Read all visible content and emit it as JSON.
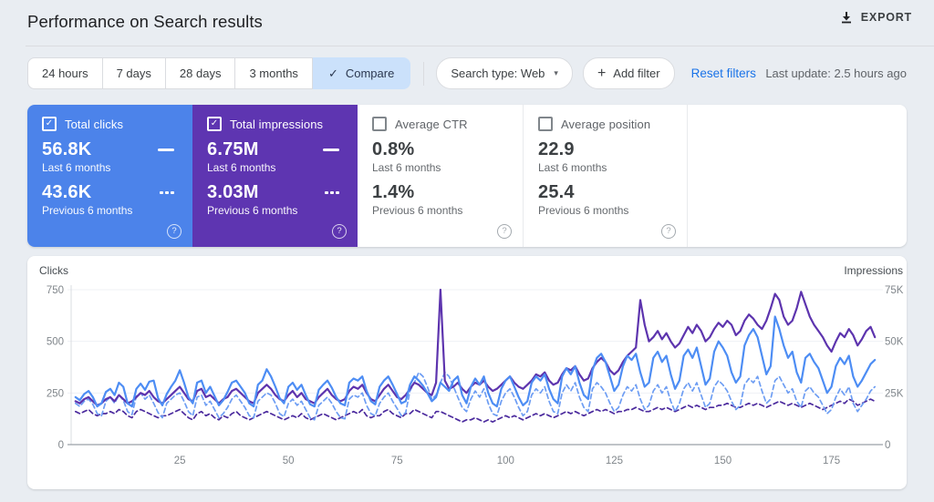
{
  "header": {
    "title": "Performance on Search results",
    "export_label": "EXPORT"
  },
  "glyphs": {
    "check": "✓",
    "plus": "+",
    "caret": "▾",
    "question": "?"
  },
  "filters": {
    "date_chips": [
      {
        "label": "24 hours",
        "selected": false
      },
      {
        "label": "7 days",
        "selected": false
      },
      {
        "label": "28 days",
        "selected": false
      },
      {
        "label": "3 months",
        "selected": false
      },
      {
        "label": "Compare",
        "selected": true
      }
    ],
    "search_type_label": "Search type: Web",
    "add_filter_label": "Add filter",
    "reset_filters_label": "Reset filters",
    "last_update": "Last update: 2.5 hours ago"
  },
  "metric_cards": [
    {
      "label": "Total clicks",
      "checked": true,
      "color": "#4c83ea",
      "value_current": "56.8K",
      "caption_current": "Last 6 months",
      "value_previous": "43.6K",
      "caption_previous": "Previous 6 months"
    },
    {
      "label": "Total impressions",
      "checked": true,
      "color": "#5e35b1",
      "value_current": "6.75M",
      "caption_current": "Last 6 months",
      "value_previous": "3.03M",
      "caption_previous": "Previous 6 months"
    },
    {
      "label": "Average CTR",
      "checked": false,
      "color": "#ffffff",
      "value_current": "0.8%",
      "caption_current": "Last 6 months",
      "value_previous": "1.4%",
      "caption_previous": "Previous 6 months"
    },
    {
      "label": "Average position",
      "checked": false,
      "color": "#ffffff",
      "value_current": "22.9",
      "caption_current": "Last 6 months",
      "value_previous": "25.4",
      "caption_previous": "Previous 6 months"
    }
  ],
  "chart_data": {
    "type": "line",
    "title": "Performance on Search results — clicks and impressions, last 6 months vs previous 6 months (daily)",
    "legend": "none",
    "grid": true,
    "axes": {
      "left": {
        "label": "Clicks",
        "ticks": [
          "0",
          "250",
          "500",
          "750"
        ],
        "tick_values": [
          0,
          250,
          500,
          750
        ],
        "range": [
          0,
          750
        ]
      },
      "right": {
        "label": "Impressions",
        "ticks": [
          "0",
          "25K",
          "50K",
          "75K"
        ],
        "tick_values": [
          0,
          25,
          50,
          75
        ],
        "range_thousands": [
          0,
          75
        ]
      },
      "x": {
        "ticks": [
          25,
          50,
          75,
          100,
          125,
          150,
          175
        ],
        "range": [
          0,
          186
        ],
        "unit": "day index"
      }
    },
    "series": [
      {
        "name": "Clicks — Last 6 months",
        "axis": "left",
        "style": "solid",
        "color": "#4d8df4",
        "unit": "clicks",
        "values": [
          230,
          215,
          245,
          260,
          230,
          185,
          200,
          255,
          270,
          240,
          300,
          280,
          200,
          185,
          270,
          295,
          265,
          305,
          310,
          225,
          190,
          245,
          280,
          310,
          360,
          300,
          230,
          200,
          300,
          310,
          250,
          280,
          235,
          190,
          215,
          255,
          300,
          310,
          280,
          250,
          200,
          185,
          290,
          310,
          365,
          330,
          280,
          225,
          200,
          280,
          300,
          265,
          290,
          240,
          195,
          185,
          265,
          290,
          310,
          275,
          230,
          200,
          190,
          300,
          320,
          310,
          330,
          260,
          210,
          195,
          280,
          310,
          330,
          290,
          245,
          200,
          210,
          290,
          330,
          310,
          285,
          250,
          210,
          230,
          300,
          280,
          260,
          310,
          330,
          240,
          200,
          280,
          320,
          290,
          330,
          250,
          200,
          185,
          270,
          310,
          330,
          280,
          230,
          190,
          210,
          300,
          330,
          310,
          340,
          270,
          220,
          200,
          330,
          370,
          340,
          380,
          300,
          240,
          220,
          360,
          420,
          440,
          400,
          330,
          260,
          290,
          380,
          430,
          410,
          440,
          350,
          280,
          300,
          420,
          450,
          400,
          430,
          340,
          270,
          310,
          430,
          460,
          420,
          470,
          380,
          290,
          320,
          450,
          500,
          470,
          430,
          350,
          300,
          330,
          480,
          530,
          560,
          520,
          430,
          340,
          380,
          620,
          560,
          480,
          420,
          450,
          350,
          300,
          420,
          440,
          400,
          370,
          310,
          250,
          280,
          380,
          420,
          390,
          430,
          330,
          280,
          310,
          350,
          390,
          410
        ]
      },
      {
        "name": "Clicks — Previous 6 months",
        "axis": "left",
        "style": "dashed",
        "color": "#6d9df3",
        "unit": "clicks",
        "values": [
          200,
          185,
          210,
          220,
          195,
          150,
          140,
          210,
          230,
          200,
          240,
          215,
          160,
          145,
          235,
          250,
          220,
          240,
          200,
          155,
          130,
          200,
          220,
          240,
          250,
          210,
          160,
          140,
          230,
          240,
          190,
          210,
          170,
          130,
          150,
          180,
          220,
          240,
          210,
          180,
          140,
          130,
          210,
          230,
          250,
          240,
          200,
          150,
          135,
          200,
          220,
          190,
          210,
          170,
          130,
          120,
          190,
          210,
          230,
          200,
          160,
          130,
          125,
          220,
          240,
          230,
          250,
          190,
          150,
          140,
          200,
          230,
          250,
          210,
          175,
          140,
          155,
          260,
          300,
          350,
          330,
          280,
          220,
          240,
          300,
          350,
          330,
          280,
          230,
          180,
          160,
          220,
          260,
          230,
          270,
          200,
          150,
          140,
          210,
          250,
          270,
          230,
          180,
          140,
          160,
          240,
          270,
          250,
          280,
          210,
          160,
          150,
          250,
          290,
          260,
          300,
          230,
          180,
          160,
          270,
          300,
          280,
          250,
          200,
          160,
          180,
          240,
          280,
          260,
          290,
          220,
          170,
          190,
          260,
          290,
          250,
          280,
          210,
          160,
          200,
          270,
          300,
          260,
          300,
          240,
          180,
          200,
          280,
          310,
          290,
          260,
          210,
          170,
          190,
          290,
          320,
          300,
          330,
          260,
          200,
          220,
          310,
          330,
          290,
          250,
          270,
          210,
          180,
          260,
          280,
          250,
          230,
          190,
          150,
          170,
          230,
          270,
          240,
          280,
          200,
          160,
          190,
          220,
          260,
          280
        ]
      },
      {
        "name": "Impressions — Last 6 months",
        "axis": "right",
        "style": "solid",
        "color": "#5d34ae",
        "unit": "thousands",
        "values": [
          21,
          20,
          22,
          23,
          21,
          19,
          20,
          22,
          23,
          21,
          24,
          22,
          20,
          21,
          23,
          25,
          24,
          26,
          23,
          21,
          20,
          22,
          24,
          26,
          28,
          25,
          22,
          21,
          26,
          27,
          23,
          24,
          22,
          20,
          22,
          23,
          26,
          27,
          25,
          23,
          21,
          20,
          25,
          27,
          29,
          27,
          24,
          22,
          21,
          24,
          26,
          23,
          25,
          22,
          21,
          20,
          23,
          25,
          27,
          24,
          22,
          21,
          22,
          26,
          28,
          27,
          29,
          25,
          22,
          21,
          24,
          27,
          29,
          26,
          23,
          22,
          24,
          27,
          30,
          29,
          27,
          25,
          24,
          30,
          75,
          31,
          27,
          28,
          30,
          27,
          25,
          28,
          30,
          29,
          31,
          28,
          26,
          27,
          29,
          31,
          33,
          30,
          28,
          27,
          29,
          31,
          34,
          33,
          35,
          31,
          29,
          30,
          34,
          37,
          36,
          38,
          34,
          31,
          32,
          37,
          40,
          42,
          40,
          36,
          34,
          36,
          40,
          43,
          45,
          47,
          70,
          58,
          50,
          52,
          55,
          51,
          54,
          50,
          47,
          49,
          53,
          57,
          54,
          58,
          55,
          50,
          52,
          56,
          59,
          57,
          60,
          58,
          53,
          55,
          60,
          63,
          61,
          58,
          56,
          60,
          66,
          73,
          70,
          62,
          58,
          60,
          66,
          74,
          68,
          62,
          58,
          55,
          52,
          48,
          45,
          50,
          54,
          52,
          56,
          53,
          48,
          51,
          55,
          57,
          52
        ]
      },
      {
        "name": "Impressions — Previous 6 months",
        "axis": "right",
        "style": "dashed",
        "color": "#4c2b9e",
        "unit": "thousands",
        "values": [
          16,
          15,
          16,
          17,
          15,
          14,
          15,
          15,
          16,
          15,
          17,
          16,
          14,
          13,
          16,
          17,
          16,
          15,
          14,
          13,
          14,
          14,
          15,
          16,
          17,
          15,
          13,
          12,
          15,
          16,
          14,
          15,
          13,
          12,
          14,
          13,
          15,
          16,
          14,
          13,
          12,
          13,
          14,
          15,
          16,
          15,
          14,
          13,
          12,
          13,
          14,
          13,
          15,
          13,
          12,
          13,
          14,
          15,
          14,
          13,
          12,
          13,
          14,
          15,
          16,
          15,
          17,
          14,
          13,
          14,
          14,
          16,
          17,
          15,
          14,
          13,
          15,
          15,
          17,
          16,
          15,
          14,
          13,
          16,
          16,
          15,
          14,
          13,
          12,
          11,
          12,
          12,
          13,
          12,
          11,
          12,
          11,
          12,
          13,
          14,
          13,
          14,
          13,
          12,
          13,
          14,
          15,
          14,
          15,
          14,
          13,
          14,
          15,
          16,
          15,
          16,
          15,
          14,
          15,
          16,
          17,
          16,
          17,
          16,
          15,
          16,
          16,
          17,
          17,
          18,
          17,
          16,
          16,
          17,
          18,
          17,
          18,
          17,
          16,
          17,
          18,
          19,
          18,
          19,
          18,
          17,
          18,
          18,
          19,
          19,
          20,
          19,
          18,
          18,
          19,
          20,
          19,
          20,
          19,
          18,
          19,
          20,
          21,
          20,
          19,
          20,
          19,
          18,
          19,
          20,
          19,
          18,
          17,
          18,
          19,
          20,
          21,
          20,
          22,
          21,
          19,
          20,
          21,
          22,
          21
        ]
      }
    ]
  }
}
